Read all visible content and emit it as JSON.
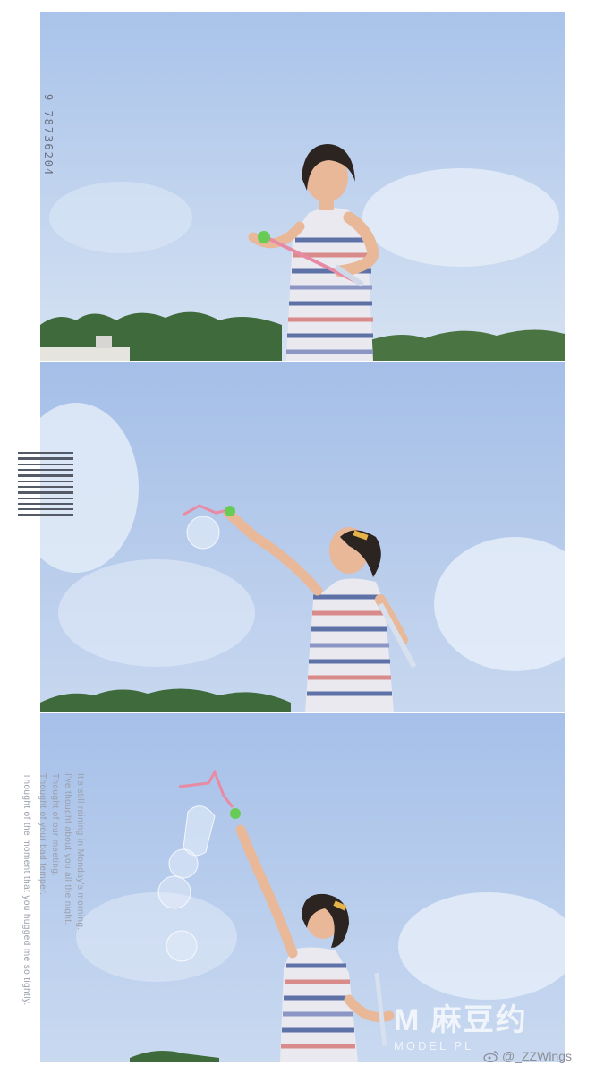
{
  "side_number": "9 78736204",
  "poem_lines": [
    "It's still raining in Monday's morning.",
    "I've thought about you all the night.",
    "Thought of our meeting.",
    "Thought of your bad temper.",
    "Thought of the moment that you hugged me so tightly."
  ],
  "watermark": {
    "main": "M 麻豆约",
    "sub": "MODEL PL"
  },
  "weibo_handle": "@_ZZWings",
  "colors": {
    "sky_top": "#aec6ea",
    "sky_bottom": "#cfdcf0",
    "trees": "#3f6a3b",
    "dress_blue": "#5e72a8",
    "dress_pink": "#d98a8a",
    "hair": "#2c2420",
    "skin": "#e8b898"
  }
}
